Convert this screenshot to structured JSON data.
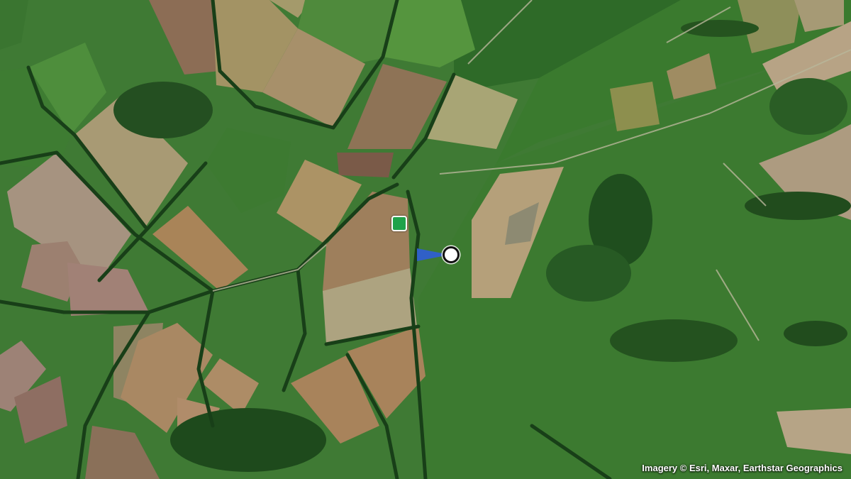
{
  "map": {
    "imagery_type": "satellite",
    "attribution": "Imagery © Esri, Maxar, Earthstar Geographics"
  },
  "markers": {
    "target": {
      "icon": "green-square-marker-icon",
      "color": "#1fa24a"
    },
    "current_location": {
      "icon": "location-dot-icon",
      "heading_color": "#2f5fd0"
    }
  },
  "colors": {
    "dark_green": "#2f6b2a",
    "field_tan": "#a88a63",
    "field_pale": "#b9ad7e",
    "field_pink": "#9b8378",
    "woodland": "#1e4a1c"
  }
}
